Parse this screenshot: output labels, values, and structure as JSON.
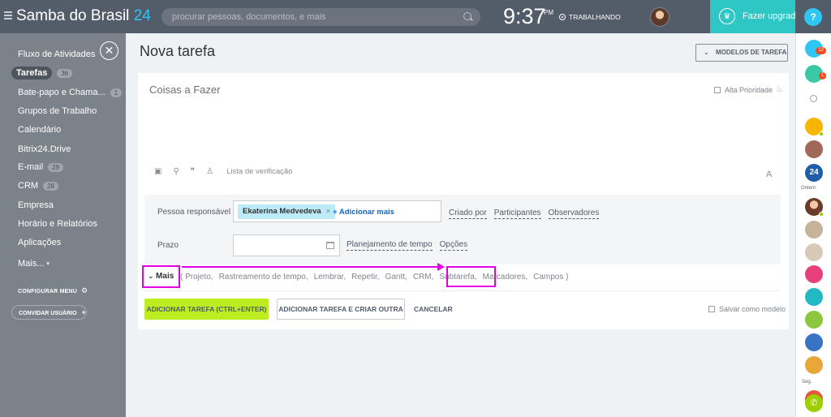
{
  "header": {
    "brand": "Samba do Brasil",
    "brand_num": "24",
    "search_placeholder": "procurar pessoas, documentos, e mais",
    "time": "9:37",
    "ampm": "PM",
    "status": "TRABALHANDO",
    "upgrade_label": "Fazer upgrade",
    "help": "?"
  },
  "leftmenu": {
    "close": "✕",
    "items": [
      {
        "label": "Fluxo de Atividades",
        "count": null
      },
      {
        "label": "Tarefas",
        "count": "36"
      },
      {
        "label": "Bate-papo e Chama...",
        "count": "1"
      },
      {
        "label": "Grupos de Trabalho",
        "count": null
      },
      {
        "label": "Calendário",
        "count": null
      },
      {
        "label": "Bitrix24.Drive",
        "count": null
      },
      {
        "label": "E-mail",
        "count": "29"
      },
      {
        "label": "CRM",
        "count": "28"
      },
      {
        "label": "Empresa",
        "count": null
      },
      {
        "label": "Horário e Relatórios",
        "count": null
      },
      {
        "label": "Aplicações",
        "count": null
      },
      {
        "label": "Mais...",
        "count": null
      }
    ],
    "config": "CONFIGURAR MENU",
    "invite": "CONVIDAR USUÁRIO"
  },
  "rightbar": {
    "notif_count": "12",
    "chat_count": "1",
    "label_ontem": "Ontem",
    "label_seg": "Seg."
  },
  "main": {
    "title": "Nova tarefa",
    "models_button": "MODELOS DE TAREFA",
    "task_placeholder": "Coisas a Fazer",
    "high_priority": "Alta Prioridade",
    "checklist": "Lista de verificação",
    "font_a": "A",
    "responsible_label": "Pessoa responsável",
    "responsible_chip": "Ekaterina Medvedeva",
    "add_more": "+ Adicionar mais",
    "links_row1": [
      "Criado por",
      "Participantes",
      "Observadores"
    ],
    "deadline_label": "Prazo",
    "links_row2": [
      "Planejamento de tempo",
      "Opções"
    ],
    "more_label": "Mais",
    "extras": [
      "( Projeto,",
      "Rastreamento de tempo,",
      "Lembrar,",
      "Repetir,",
      "Gantt,",
      "CRM,",
      "Subtarefa,",
      "Marcadores,",
      "Campos )"
    ],
    "add_task": "ADICIONAR TAREFA (CTRL+ENTER)",
    "add_task_another": "ADICIONAR TAREFA E CRIAR OUTRA",
    "cancel": "CANCELAR",
    "save_model": "Salvar como modelo"
  },
  "colors": {
    "header_bg": "#535c69",
    "accent_blue": "#2fc6f6",
    "upgrade_bg": "#2fc6c6",
    "primary_button": "#bbed21",
    "annotation": "#e400e4"
  }
}
